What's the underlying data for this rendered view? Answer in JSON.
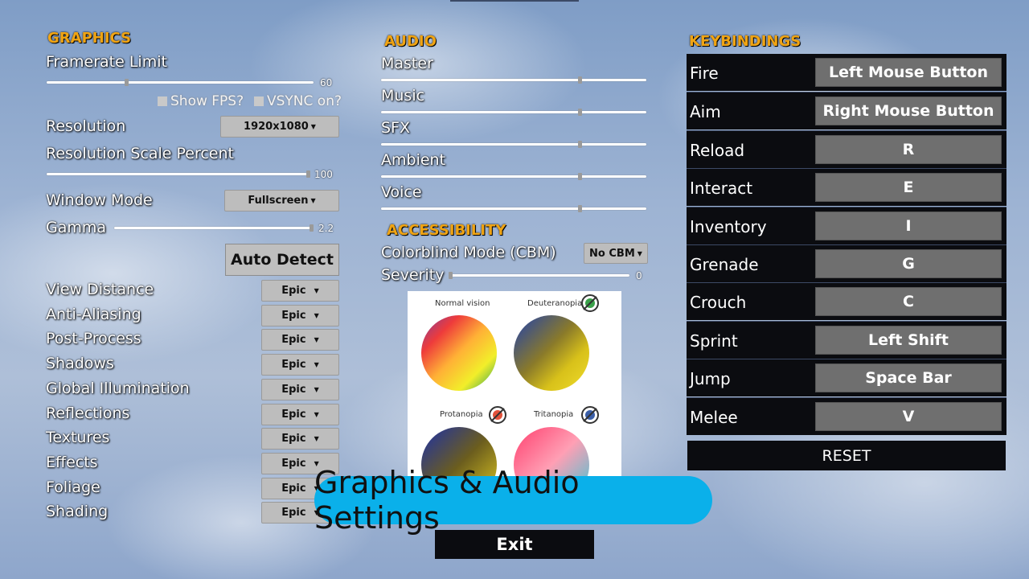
{
  "colors": {
    "accent_title": "#f0a413",
    "banner": "#0ab0ea",
    "panel_dark": "#0b0c10",
    "key_button": "#6f6f6f"
  },
  "graphics": {
    "title": "GRAPHICS",
    "framerate": {
      "label": "Framerate Limit",
      "value": "60",
      "fraction": 0.3
    },
    "show_fps": "Show FPS?",
    "vsync": "VSYNC on?",
    "resolution": {
      "label": "Resolution",
      "value": "1920x1080"
    },
    "res_scale": {
      "label": "Resolution Scale Percent",
      "value": "100",
      "fraction": 1.0
    },
    "window_mode": {
      "label": "Window Mode",
      "value": "Fullscreen"
    },
    "gamma": {
      "label": "Gamma",
      "value": "2.2",
      "fraction": 1.0
    },
    "auto_detect": "Auto Detect",
    "quality": [
      {
        "label": "View Distance",
        "value": "Epic"
      },
      {
        "label": "Anti-Aliasing",
        "value": "Epic"
      },
      {
        "label": "Post-Process",
        "value": "Epic"
      },
      {
        "label": "Shadows",
        "value": "Epic"
      },
      {
        "label": "Global Illumination",
        "value": "Epic"
      },
      {
        "label": "Reflections",
        "value": "Epic"
      },
      {
        "label": "Textures",
        "value": "Epic"
      },
      {
        "label": "Effects",
        "value": "Epic"
      },
      {
        "label": "Foliage",
        "value": "Epic"
      },
      {
        "label": "Shading",
        "value": "Epic"
      }
    ]
  },
  "audio": {
    "title": "AUDIO",
    "channels": [
      {
        "label": "Master",
        "fraction": 0.75
      },
      {
        "label": "Music",
        "fraction": 0.75
      },
      {
        "label": "SFX",
        "fraction": 0.75
      },
      {
        "label": "Ambient",
        "fraction": 0.75
      },
      {
        "label": "Voice",
        "fraction": 0.75
      }
    ]
  },
  "accessibility": {
    "title": "ACCESSIBILITY",
    "colorblind": {
      "label": "Colorblind Mode (CBM)",
      "value": "No CBM"
    },
    "severity": {
      "label": "Severity",
      "value": "0",
      "fraction": 0.0
    },
    "wheels": {
      "normal": "Normal vision",
      "deuteranopia": "Deuteranopia",
      "protanopia": "Protanopia",
      "tritanopia": "Tritanopia"
    }
  },
  "keybindings": {
    "title": "KEYBINDINGS",
    "rows": [
      {
        "action": "Fire",
        "key": "Left Mouse Button"
      },
      {
        "action": "Aim",
        "key": "Right Mouse Button"
      },
      {
        "action": "Reload",
        "key": "R"
      },
      {
        "action": "Interact",
        "key": "E"
      },
      {
        "action": "Inventory",
        "key": "I"
      },
      {
        "action": "Grenade",
        "key": "G"
      },
      {
        "action": "Crouch",
        "key": "C"
      },
      {
        "action": "Sprint",
        "key": "Left Shift"
      },
      {
        "action": "Jump",
        "key": "Space Bar"
      },
      {
        "action": "Melee",
        "key": "V"
      }
    ],
    "reset": "RESET"
  },
  "banner": "Graphics & Audio Settings",
  "exit": "Exit"
}
